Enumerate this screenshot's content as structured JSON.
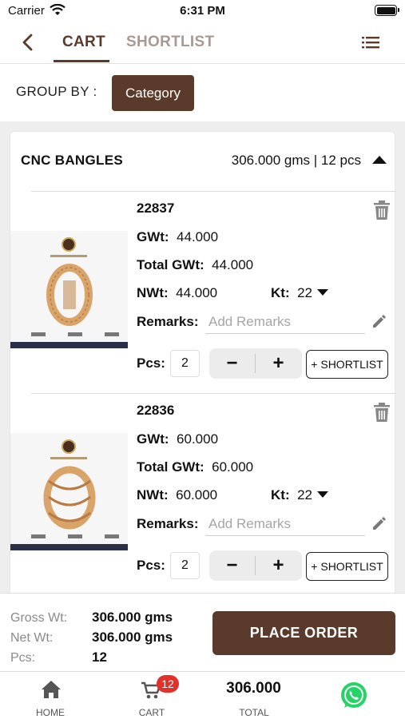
{
  "status_bar": {
    "carrier": "Carrier",
    "time": "6:31 PM"
  },
  "nav": {
    "tabs": [
      {
        "label": "CART",
        "active": true
      },
      {
        "label": "SHORTLIST",
        "active": false
      }
    ]
  },
  "group_by": {
    "label": "GROUP BY :",
    "value": "Category"
  },
  "category": {
    "title": "CNC BANGLES",
    "summary": "306.000 gms | 12 pcs"
  },
  "labels": {
    "gwt": "GWt:",
    "total_gwt": "Total GWt:",
    "nwt": "NWt:",
    "kt": "Kt:",
    "remarks": "Remarks:",
    "remarks_placeholder": "Add Remarks",
    "pcs": "Pcs:",
    "minus": "−",
    "plus": "+",
    "shortlist_button": "+ SHORTLIST"
  },
  "items": [
    {
      "code": "22837",
      "gwt": "44.000",
      "total_gwt": "44.000",
      "nwt": "44.000",
      "kt": "22",
      "pcs": "2"
    },
    {
      "code": "22836",
      "gwt": "60.000",
      "total_gwt": "60.000",
      "nwt": "60.000",
      "kt": "22",
      "pcs": "2"
    }
  ],
  "summary": {
    "gross_label": "Gross Wt:",
    "gross_value": "306.000 gms",
    "net_label": "Net Wt:",
    "net_value": "306.000 gms",
    "pcs_label": "Pcs:",
    "pcs_value": "12",
    "place_order": "PLACE ORDER"
  },
  "tabbar": {
    "home": "HOME",
    "cart": "CART",
    "cart_badge": "12",
    "total_value": "306.000",
    "total_label": "TOTAL"
  },
  "colors": {
    "brand": "#5a3a2a",
    "badge": "#e0312b",
    "whatsapp": "#25d366"
  },
  "icons": [
    "wifi-icon",
    "battery-icon",
    "back-icon",
    "menu-icon",
    "collapse-icon",
    "trash-icon",
    "edit-icon",
    "home-icon",
    "cart-icon",
    "whatsapp-icon"
  ]
}
